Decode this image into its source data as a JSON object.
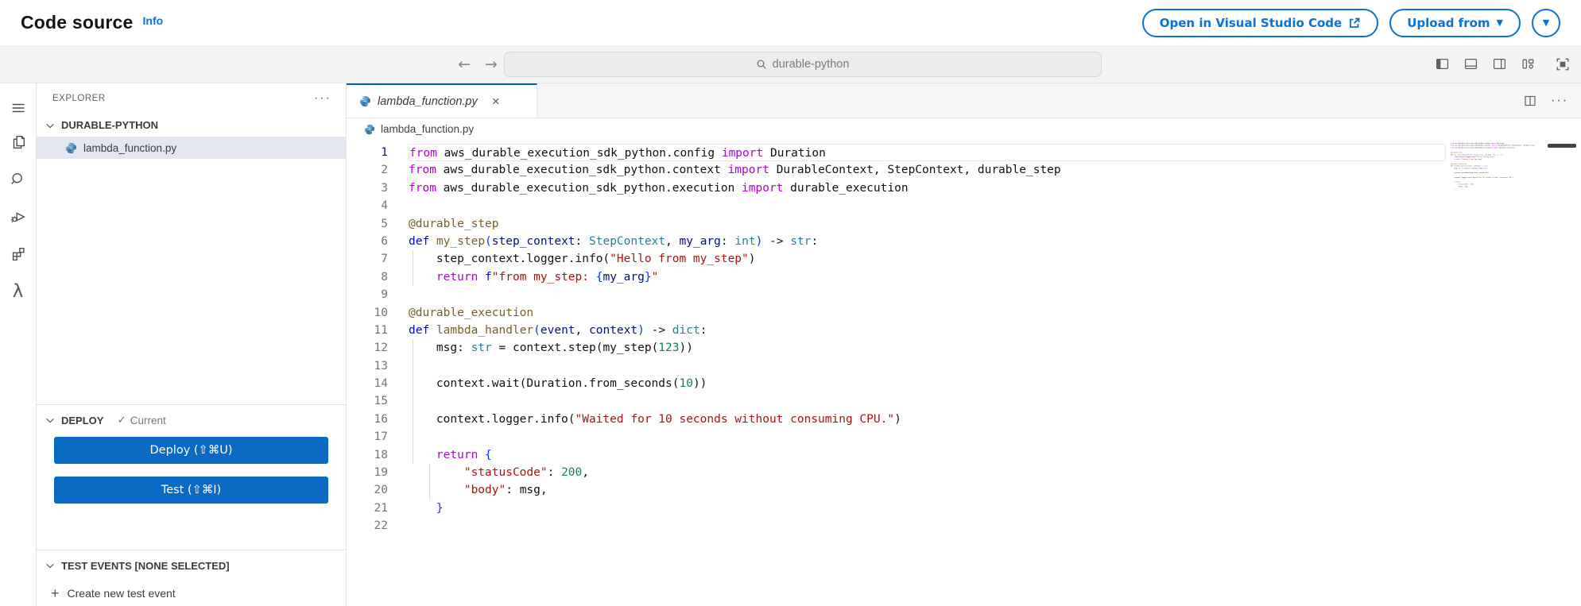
{
  "header": {
    "title": "Code source",
    "info_link": "Info",
    "open_vscode_label": "Open in Visual Studio Code",
    "upload_from_label": "Upload from"
  },
  "titlebar": {
    "search_value": "durable-python"
  },
  "sidebar": {
    "explorer_title": "EXPLORER",
    "folder_name": "DURABLE-PYTHON",
    "file_name": "lambda_function.py",
    "deploy": {
      "title": "DEPLOY",
      "status": "Current",
      "deploy_button": "Deploy (⇧⌘U)",
      "test_button": "Test (⇧⌘I)"
    },
    "test_events": {
      "title": "TEST EVENTS [NONE SELECTED]",
      "create_label": "Create new test event"
    }
  },
  "editor": {
    "tab_name": "lambda_function.py",
    "breadcrumb": "lambda_function.py"
  },
  "glyphs": {
    "back": "←",
    "forward": "→",
    "more": "···",
    "close": "×",
    "check": "✓",
    "caret": "▼",
    "plus": "+",
    "lambda": "λ"
  },
  "colors": {
    "aws_accent": "#0972d3",
    "button_blue": "#0a69c2",
    "tab_accent": "#005fb8",
    "selection_bg": "#e4e6f1"
  },
  "code": {
    "line_count": 22,
    "active_line": 1,
    "lines": [
      {
        "g": [],
        "t": [
          [
            "from",
            "k"
          ],
          [
            " aws_durable_execution_sdk_python.config ",
            "p"
          ],
          [
            "import",
            "k"
          ],
          [
            " Duration",
            "p"
          ]
        ]
      },
      {
        "g": [],
        "t": [
          [
            "from",
            "k"
          ],
          [
            " aws_durable_execution_sdk_python.context ",
            "p"
          ],
          [
            "import",
            "k"
          ],
          [
            " DurableContext, StepContext, durable_step",
            "p"
          ]
        ]
      },
      {
        "g": [],
        "t": [
          [
            "from",
            "k"
          ],
          [
            " aws_durable_execution_sdk_python.execution ",
            "p"
          ],
          [
            "import",
            "k"
          ],
          [
            " durable_execution",
            "p"
          ]
        ]
      },
      {
        "g": [],
        "t": []
      },
      {
        "g": [],
        "t": [
          [
            "@durable_step",
            "f"
          ]
        ]
      },
      {
        "g": [],
        "t": [
          [
            "def",
            "d"
          ],
          [
            " ",
            "p"
          ],
          [
            "my_step",
            "f"
          ],
          [
            "(",
            "b"
          ],
          [
            "step_context",
            "v"
          ],
          [
            ": ",
            "p"
          ],
          [
            "StepContext",
            "t"
          ],
          [
            ", ",
            "p"
          ],
          [
            "my_arg",
            "v"
          ],
          [
            ": ",
            "p"
          ],
          [
            "int",
            "t"
          ],
          [
            ")",
            "b"
          ],
          [
            " -> ",
            "p"
          ],
          [
            "str",
            "t"
          ],
          [
            ":",
            "p"
          ]
        ]
      },
      {
        "g": [
          1
        ],
        "t": [
          [
            "    step_context.logger.info(",
            "p"
          ],
          [
            "\"Hello from my_step\"",
            "s"
          ],
          [
            ")",
            "p"
          ]
        ]
      },
      {
        "g": [
          1
        ],
        "t": [
          [
            "    ",
            "p"
          ],
          [
            "return",
            "k"
          ],
          [
            " ",
            "p"
          ],
          [
            "f",
            "d"
          ],
          [
            "\"from my_step: ",
            "s"
          ],
          [
            "{",
            "b"
          ],
          [
            "my_arg",
            "v"
          ],
          [
            "}",
            "b"
          ],
          [
            "\"",
            "s"
          ]
        ]
      },
      {
        "g": [],
        "t": []
      },
      {
        "g": [],
        "t": [
          [
            "@durable_execution",
            "f"
          ]
        ]
      },
      {
        "g": [],
        "t": [
          [
            "def",
            "d"
          ],
          [
            " ",
            "p"
          ],
          [
            "lambda_handler",
            "f"
          ],
          [
            "(",
            "b"
          ],
          [
            "event",
            "v"
          ],
          [
            ", ",
            "p"
          ],
          [
            "context",
            "v"
          ],
          [
            ")",
            "b"
          ],
          [
            " -> ",
            "p"
          ],
          [
            "dict",
            "t"
          ],
          [
            ":",
            "p"
          ]
        ]
      },
      {
        "g": [
          1
        ],
        "t": [
          [
            "    msg",
            "p"
          ],
          [
            ": ",
            "p"
          ],
          [
            "str",
            "t"
          ],
          [
            " = context.step(my_step(",
            "p"
          ],
          [
            "123",
            "n"
          ],
          [
            "))",
            "p"
          ]
        ]
      },
      {
        "g": [
          1
        ],
        "t": []
      },
      {
        "g": [
          1
        ],
        "t": [
          [
            "    context.wait(Duration.from_seconds(",
            "p"
          ],
          [
            "10",
            "n"
          ],
          [
            "))",
            "p"
          ]
        ]
      },
      {
        "g": [
          1
        ],
        "t": []
      },
      {
        "g": [
          1
        ],
        "t": [
          [
            "    context.logger.info(",
            "p"
          ],
          [
            "\"Waited for 10 seconds without consuming CPU.\"",
            "s"
          ],
          [
            ")",
            "p"
          ]
        ]
      },
      {
        "g": [
          1
        ],
        "t": []
      },
      {
        "g": [
          1
        ],
        "t": [
          [
            "    ",
            "p"
          ],
          [
            "return",
            "k"
          ],
          [
            " ",
            "p"
          ],
          [
            "{",
            "b"
          ]
        ]
      },
      {
        "g": [
          5
        ],
        "t": [
          [
            "        ",
            "p"
          ],
          [
            "\"statusCode\"",
            "s"
          ],
          [
            ": ",
            "p"
          ],
          [
            "200",
            "n"
          ],
          [
            ",",
            "p"
          ]
        ]
      },
      {
        "g": [
          5
        ],
        "t": [
          [
            "        ",
            "p"
          ],
          [
            "\"body\"",
            "s"
          ],
          [
            ": msg,",
            "p"
          ]
        ]
      },
      {
        "g": [],
        "t": [
          [
            "    ",
            "p"
          ],
          [
            "}",
            "b"
          ]
        ]
      },
      {
        "g": [],
        "t": []
      }
    ]
  }
}
